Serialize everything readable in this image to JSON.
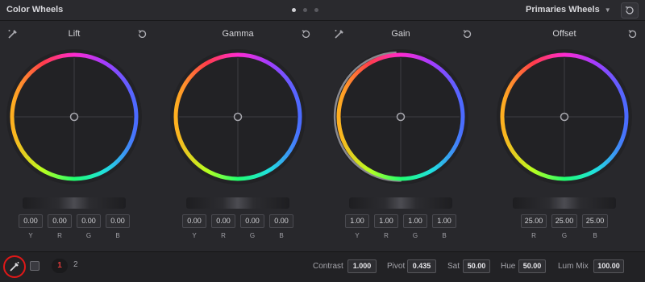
{
  "header": {
    "title": "Color Wheels",
    "mode": "Primaries Wheels",
    "pages": [
      true,
      false,
      false
    ]
  },
  "wheels": [
    {
      "label": "Lift",
      "values": [
        "0.00",
        "0.00",
        "0.00",
        "0.00"
      ],
      "axes": [
        "Y",
        "R",
        "G",
        "B"
      ]
    },
    {
      "label": "Gamma",
      "values": [
        "0.00",
        "0.00",
        "0.00",
        "0.00"
      ],
      "axes": [
        "Y",
        "R",
        "G",
        "B"
      ]
    },
    {
      "label": "Gain",
      "values": [
        "1.00",
        "1.00",
        "1.00",
        "1.00"
      ],
      "axes": [
        "Y",
        "R",
        "G",
        "B"
      ]
    },
    {
      "label": "Offset",
      "values": [
        "25.00",
        "25.00",
        "25.00"
      ],
      "axes": [
        "R",
        "G",
        "B"
      ]
    }
  ],
  "footer": {
    "page_current": "1",
    "page_other": "2",
    "contrast_label": "Contrast",
    "contrast_value": "1.000",
    "pivot_label": "Pivot",
    "pivot_value": "0.435",
    "sat_label": "Sat",
    "sat_value": "50.00",
    "hue_label": "Hue",
    "hue_value": "50.00",
    "lummix_label": "Lum Mix",
    "lummix_value": "100.00"
  },
  "colors": {
    "highlight_ring": "#e01818",
    "page_active": "#e23a3a"
  },
  "icons": {
    "reset": "reset-icon",
    "picker": "color-picker-icon",
    "auto_balance": "auto-balance-icon"
  }
}
